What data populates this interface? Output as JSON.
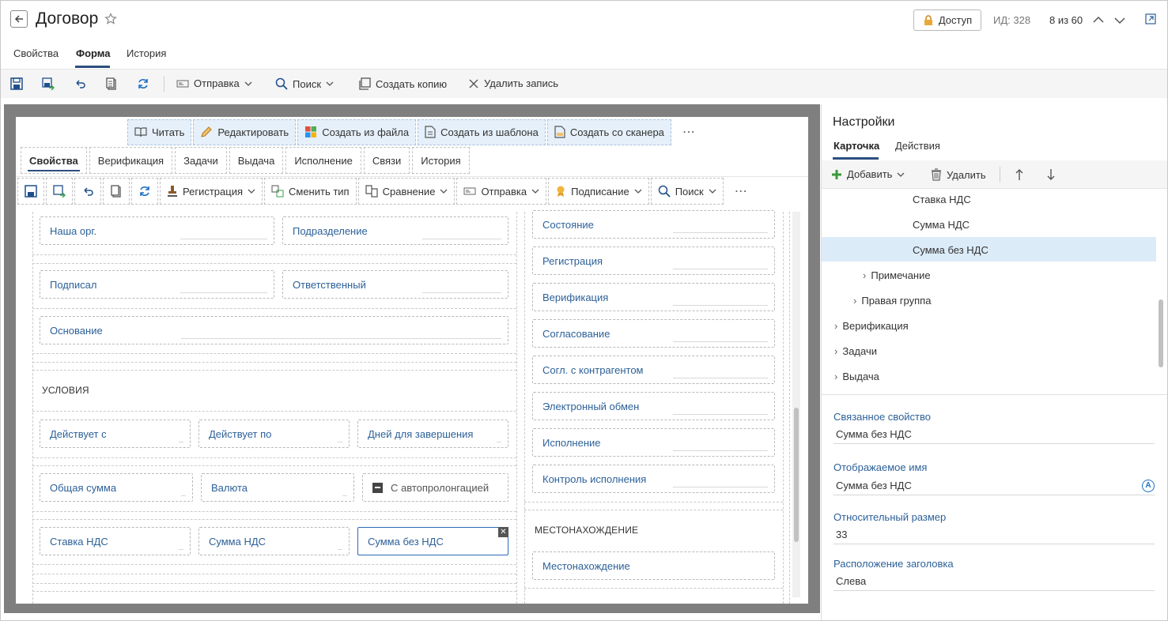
{
  "header": {
    "title": "Договор",
    "access": "Доступ",
    "id": "ИД: 328",
    "pager": "8 из 60"
  },
  "tabs": [
    "Свойства",
    "Форма",
    "История"
  ],
  "toolbar": {
    "send": "Отправка",
    "search": "Поиск",
    "copy": "Создать копию",
    "delete": "Удалить запись"
  },
  "form": {
    "top_buttons": [
      "Читать",
      "Редактировать",
      "Создать из файла",
      "Создать из шаблона",
      "Создать со сканера"
    ],
    "tabs": [
      "Свойства",
      "Верификация",
      "Задачи",
      "Выдача",
      "Исполнение",
      "Связи",
      "История"
    ],
    "toolbar": {
      "registration": "Регистрация",
      "change_type": "Сменить тип",
      "compare": "Сравнение",
      "send": "Отправка",
      "sign": "Подписание",
      "search": "Поиск"
    },
    "left_fields": {
      "our_org": "Наша орг.",
      "department": "Подразделение",
      "signed": "Подписал",
      "responsible": "Ответственный",
      "basis": "Основание",
      "conditions": "УСЛОВИЯ",
      "valid_from": "Действует с",
      "valid_to": "Действует по",
      "days": "Дней для завершения",
      "total": "Общая сумма",
      "currency": "Валюта",
      "autoprolong": "С автопролонгацией",
      "vat_rate": "Ставка НДС",
      "vat_sum": "Сумма НДС",
      "sum_no_vat": "Сумма без НДС"
    },
    "right_fields": [
      "Состояние",
      "Регистрация",
      "Верификация",
      "Согласование",
      "Согл. с контрагентом",
      "Электронный обмен",
      "Исполнение",
      "Контроль исполнения"
    ],
    "location_header": "МЕСТОНАХОЖДЕНИЕ",
    "location_field": "Местонахождение"
  },
  "settings": {
    "title": "Настройки",
    "tabs": [
      "Карточка",
      "Действия"
    ],
    "add": "Добавить",
    "delete": "Удалить",
    "tree": [
      "Ставка НДС",
      "Сумма НДС",
      "Сумма без НДС",
      "Примечание",
      "Правая группа",
      "Верификация",
      "Задачи",
      "Выдача"
    ],
    "props": {
      "linked_label": "Связанное свойство",
      "linked_value": "Сумма без НДС",
      "display_label": "Отображаемое имя",
      "display_value": "Сумма без НДС",
      "size_label": "Относительный размер",
      "size_value": "33",
      "caption_label": "Расположение заголовка",
      "caption_value": "Слева"
    }
  },
  "colors": {
    "accent": "#1f6fc5",
    "link": "#2d6199",
    "selected": "#dcebf8",
    "canvas": "#7f7f7f"
  }
}
